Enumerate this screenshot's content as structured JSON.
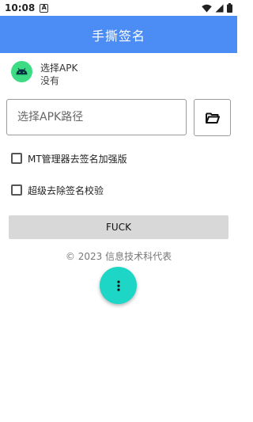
{
  "status_bar": {
    "time": "10:08",
    "notification_glyph": "A"
  },
  "app_bar": {
    "title": "手撕签名"
  },
  "apk": {
    "title": "选择APK",
    "subtitle": "没有"
  },
  "path_input": {
    "placeholder": "选择APK路径",
    "value": ""
  },
  "options": [
    {
      "label": "MT管理器去签名加强版",
      "checked": false
    },
    {
      "label": "超级去除签名校验",
      "checked": false
    }
  ],
  "action_button": {
    "label": "FUCK"
  },
  "footer": {
    "copyright": "© 2023 信息技术科代表"
  },
  "colors": {
    "app_bar": "#4c8cf5",
    "fab": "#1dd6c6",
    "action_button": "#d8d8d8",
    "android_green": "#3ddc84"
  }
}
